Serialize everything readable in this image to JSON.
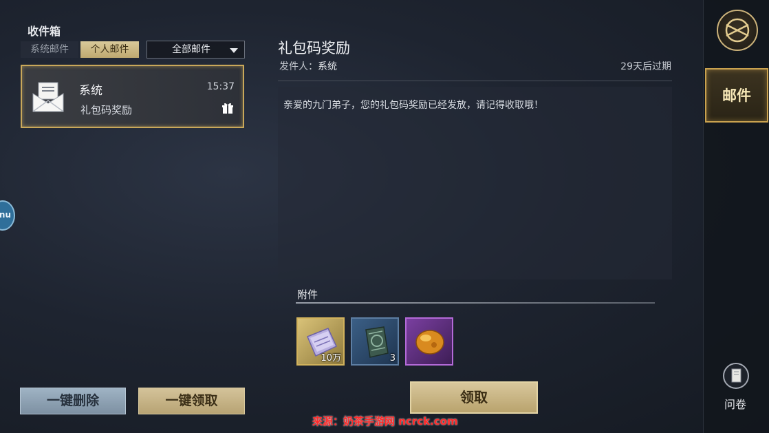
{
  "inbox": {
    "title": "收件箱",
    "tabs": [
      {
        "label": "系统邮件",
        "active": false
      },
      {
        "label": "个人邮件",
        "active": true
      }
    ],
    "filter": {
      "selected": "全部邮件"
    },
    "mails": [
      {
        "sender": "系统",
        "time": "15:37",
        "subject": "礼包码奖励",
        "icon": "envelope-icon",
        "has_gift": true
      }
    ],
    "delete_all_label": "一键删除",
    "claim_all_label": "一键领取"
  },
  "side_bubble": {
    "label": "nu"
  },
  "detail": {
    "title": "礼包码奖励",
    "sender_prefix": "发件人：",
    "sender": "系统",
    "expire": "29天后过期",
    "body": "亲爱的九门弟子，您的礼包码奖励已经发放，请记得收取哦！",
    "attachments_label": "附件",
    "attachments": [
      {
        "icon": "silver-notes-icon",
        "count": "10万",
        "rarity_color": "#d1b25c"
      },
      {
        "icon": "bronze-artifact-icon",
        "count": "3",
        "rarity_color": "#5d7ea3"
      },
      {
        "icon": "amber-gem-icon",
        "count": "",
        "rarity_color": "#b46ad8"
      }
    ],
    "claim_label": "领取"
  },
  "sidebar": {
    "emblem_icon": "emblem-icon",
    "mail_label": "邮件",
    "survey_label": "问卷",
    "survey_icon": "book-icon"
  },
  "watermark": "来源：奶茶手游网 ncrck.com"
}
